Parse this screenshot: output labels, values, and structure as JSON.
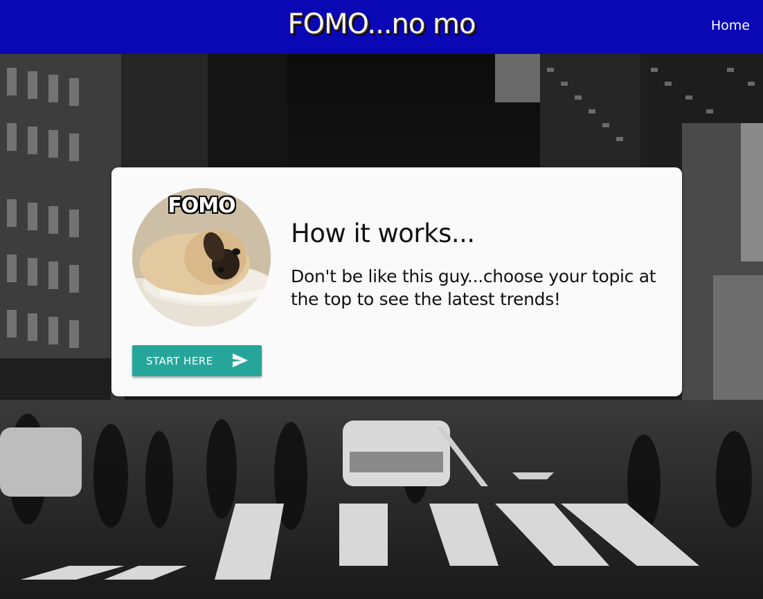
{
  "navbar": {
    "brand": "FOMO...no mo",
    "home_link": "Home"
  },
  "card": {
    "image_caption": "FOMO",
    "title": "How it works...",
    "text": "Don't be like this guy...choose your topic at the top to see the latest trends!",
    "button_label": "Start Here",
    "button_icon": "send-icon"
  },
  "colors": {
    "navbar": "#0a08b5",
    "button": "#26a69a",
    "card": "#fafafa"
  }
}
